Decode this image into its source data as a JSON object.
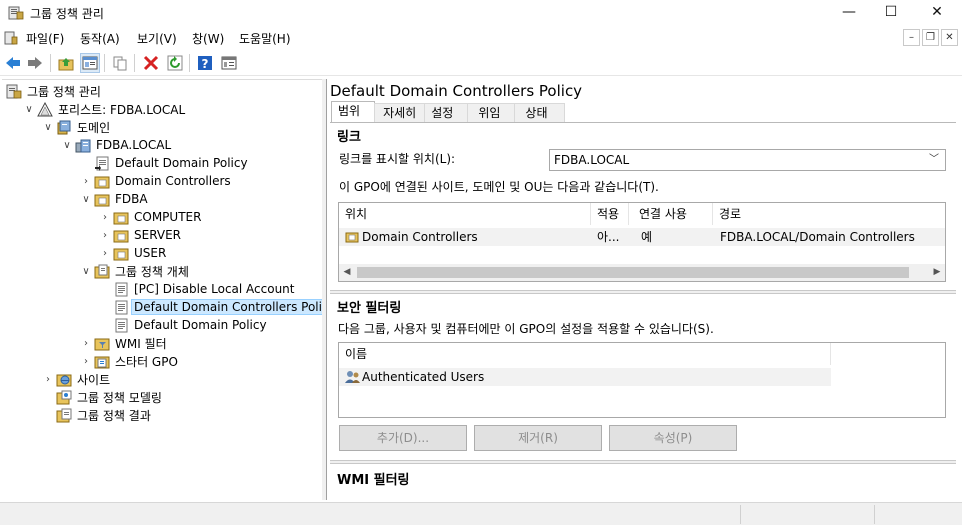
{
  "window": {
    "title": "그룹 정책 관리",
    "minimize": "—",
    "maximize": "☐",
    "close": "✕"
  },
  "menu": {
    "items": [
      "파일(F)",
      "동작(A)",
      "보기(V)",
      "창(W)",
      "도움말(H)"
    ],
    "mdi_minimize": "–",
    "mdi_restore": "❐",
    "mdi_close": "✕"
  },
  "toolbar": {
    "icons": [
      "back-arrow-icon",
      "forward-arrow-icon",
      "up-folder-icon",
      "show-hide-tree-icon",
      "copy-icon",
      "delete-icon",
      "refresh-icon",
      "help-icon",
      "properties-icon"
    ]
  },
  "tree": {
    "items": [
      {
        "label": "그룹 정책 관리",
        "icon": "gpm-icon",
        "level": 0,
        "chevron": ""
      },
      {
        "label": "포리스트: FDBA.LOCAL",
        "icon": "forest-icon",
        "level": 1,
        "chevron": "down"
      },
      {
        "label": "도메인",
        "icon": "domains-icon",
        "level": 2,
        "chevron": "down"
      },
      {
        "label": "FDBA.LOCAL",
        "icon": "domain-icon",
        "level": 3,
        "chevron": "down"
      },
      {
        "label": "Default Domain Policy",
        "icon": "gpo-link-icon",
        "level": 4,
        "chevron": ""
      },
      {
        "label": "Domain Controllers",
        "icon": "ou-icon",
        "level": 4,
        "chevron": "right"
      },
      {
        "label": "FDBA",
        "icon": "ou-icon",
        "level": 4,
        "chevron": "down"
      },
      {
        "label": "COMPUTER",
        "icon": "ou-icon",
        "level": 5,
        "chevron": "right"
      },
      {
        "label": "SERVER",
        "icon": "ou-icon",
        "level": 5,
        "chevron": "right"
      },
      {
        "label": "USER",
        "icon": "ou-icon",
        "level": 5,
        "chevron": "right"
      },
      {
        "label": "그룹 정책 개체",
        "icon": "gpo-container-icon",
        "level": 4,
        "chevron": "down"
      },
      {
        "label": "[PC] Disable Local Account",
        "icon": "gpo-icon",
        "level": 5,
        "chevron": ""
      },
      {
        "label": "Default Domain Controllers Policy",
        "icon": "gpo-icon",
        "level": 5,
        "chevron": "",
        "selected": true
      },
      {
        "label": "Default Domain Policy",
        "icon": "gpo-icon",
        "level": 5,
        "chevron": ""
      },
      {
        "label": "WMI 필터",
        "icon": "wmi-filter-icon",
        "level": 4,
        "chevron": "right"
      },
      {
        "label": "스타터 GPO",
        "icon": "starter-gpo-icon",
        "level": 4,
        "chevron": "right"
      },
      {
        "label": "사이트",
        "icon": "sites-icon",
        "level": 2,
        "chevron": "right"
      },
      {
        "label": "그룹 정책 모델링",
        "icon": "modeling-icon",
        "level": 2,
        "chevron": ""
      },
      {
        "label": "그룹 정책 결과",
        "icon": "results-icon",
        "level": 2,
        "chevron": ""
      }
    ]
  },
  "details": {
    "title": "Default Domain Controllers Policy",
    "tabs": [
      "범위",
      "자세히",
      "설정",
      "위임",
      "상태"
    ],
    "links": {
      "section_title": "링크",
      "location_label": "링크를 표시할 위치(L):",
      "location_value": "FDBA.LOCAL",
      "description": "이 GPO에 연결된 사이트, 도메인 및 OU는 다음과 같습니다(T).",
      "columns": [
        "위치",
        "적용",
        "연결 사용",
        "경로"
      ],
      "rows": [
        {
          "location": "Domain Controllers",
          "enforced": "아...",
          "enabled": "예",
          "path": "FDBA.LOCAL/Domain Controllers"
        }
      ]
    },
    "security": {
      "section_title": "보안 필터링",
      "description": "다음 그룹, 사용자 및 컴퓨터에만 이 GPO의 설정을 적용할 수 있습니다(S).",
      "column": "이름",
      "rows": [
        "Authenticated Users"
      ],
      "add_button": "추가(D)...",
      "remove_button": "제거(R)",
      "properties_button": "속성(P)"
    },
    "wmi": {
      "section_title": "WMI 필터링"
    }
  }
}
